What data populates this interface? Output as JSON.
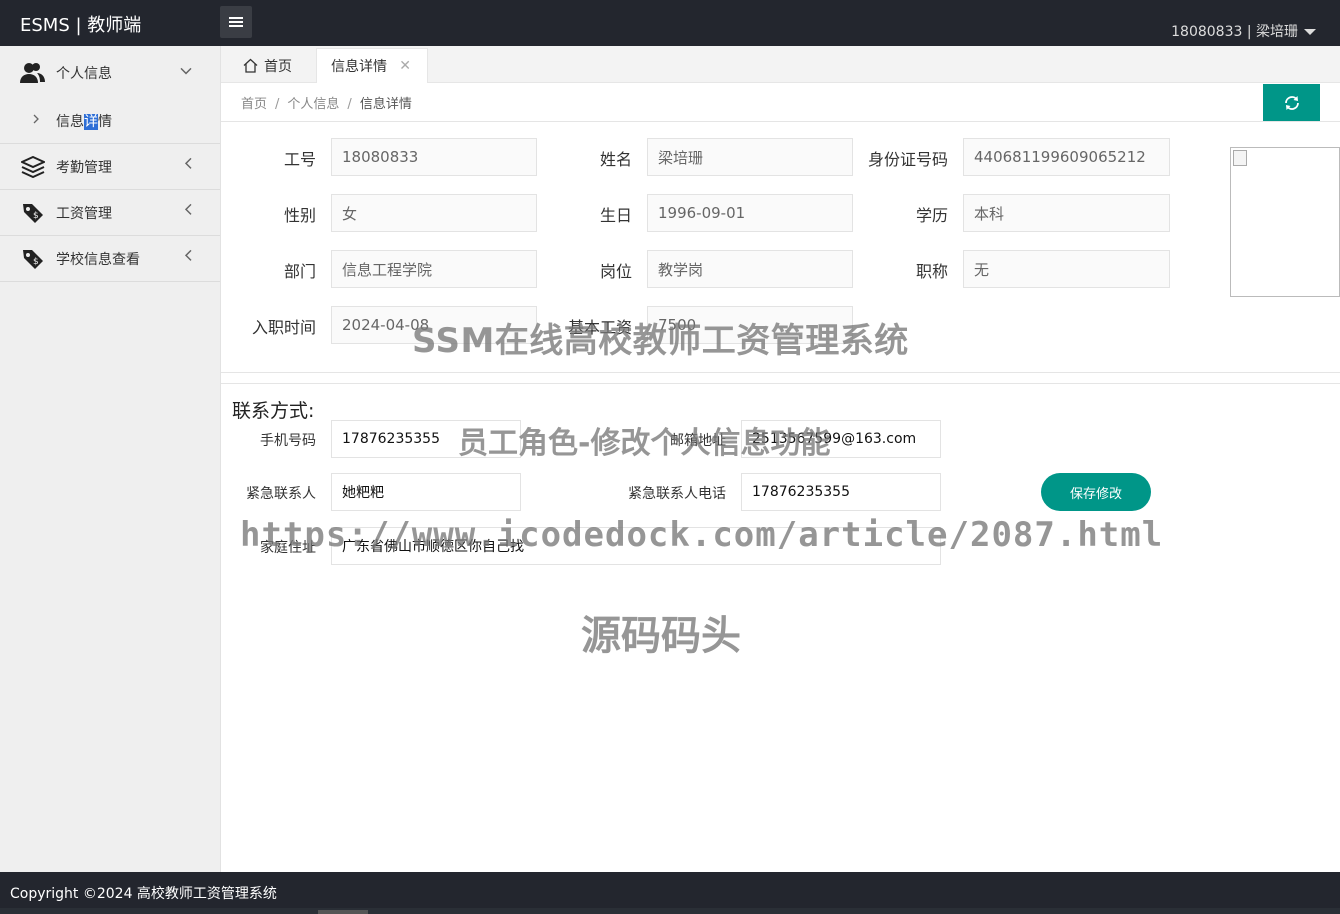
{
  "header": {
    "brand": "ESMS | 教师端",
    "user": "18080833 | 梁培珊"
  },
  "sidebar": {
    "items": [
      {
        "label": "个人信息",
        "icon": "user-group-icon",
        "expanded": true
      },
      {
        "label": "考勤管理",
        "icon": "layers-icon"
      },
      {
        "label": "工资管理",
        "icon": "price-tag-icon"
      },
      {
        "label": "学校信息查看",
        "icon": "price-tag-icon"
      }
    ],
    "sub_item": {
      "label_a": "信息",
      "label_b": "详",
      "label_c": "情"
    }
  },
  "tabs": {
    "home": "首页",
    "active": "信息详情"
  },
  "breadcrumb": {
    "items": [
      "首页",
      "个人信息",
      "信息详情"
    ],
    "sep": "/"
  },
  "profile": {
    "labels": {
      "id": "工号",
      "name": "姓名",
      "idcard": "身份证号码",
      "gender": "性别",
      "birthday": "生日",
      "education": "学历",
      "dept": "部门",
      "post": "岗位",
      "title": "职称",
      "hire_date": "入职时间",
      "base_salary": "基本工资"
    },
    "values": {
      "id": "18080833",
      "name": "梁培珊",
      "idcard": "440681199609065212",
      "gender": "女",
      "birthday": "1996-09-01",
      "education": "本科",
      "dept": "信息工程学院",
      "post": "教学岗",
      "title": "无",
      "hire_date": "2024-04-08",
      "base_salary": "7500"
    }
  },
  "contact": {
    "title": "联系方式:",
    "labels": {
      "phone": "手机号码",
      "email": "邮箱地址",
      "emergency_contact": "紧急联系人",
      "emergency_phone": "紧急联系人电话",
      "address": "家庭住址"
    },
    "values": {
      "phone": "17876235355",
      "email": "2513567599@163.com",
      "emergency_contact": "她粑粑",
      "emergency_phone": "17876235355",
      "address": "广东省佛山市顺德区你自己找"
    },
    "save_label": "保存修改"
  },
  "watermarks": {
    "line1": "SSM在线高校教师工资管理系统",
    "line2": "员工角色-修改个人信息功能",
    "line3": "https://www.icodedock.com/article/2087.html",
    "line4": "源码码头"
  },
  "footer": {
    "text": "Copyright ©2024 高校教师工资管理系统"
  },
  "colors": {
    "header_bg": "#23262e",
    "accent": "#009688",
    "sidebar_bg": "#efefef"
  }
}
